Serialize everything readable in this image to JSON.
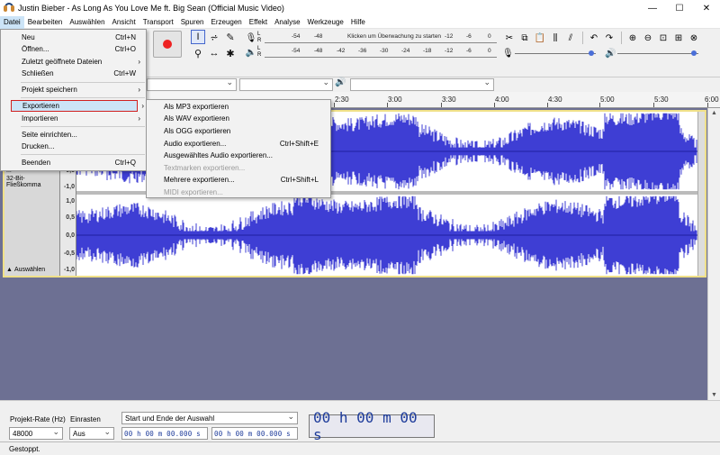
{
  "window": {
    "title": "Justin Bieber - As Long As You Love Me ft. Big Sean (Official Music Video)",
    "minimize": "—",
    "maximize": "☐",
    "close": "✕"
  },
  "menubar": [
    "Datei",
    "Bearbeiten",
    "Auswählen",
    "Ansicht",
    "Transport",
    "Spuren",
    "Erzeugen",
    "Effekt",
    "Analyse",
    "Werkzeuge",
    "Hilfe"
  ],
  "file_menu": {
    "new": {
      "label": "Neu",
      "shortcut": "Ctrl+N"
    },
    "open": {
      "label": "Öffnen...",
      "shortcut": "Ctrl+O"
    },
    "recent": {
      "label": "Zuletzt geöffnete Dateien"
    },
    "close": {
      "label": "Schließen",
      "shortcut": "Ctrl+W"
    },
    "save_project": {
      "label": "Projekt speichern"
    },
    "export": {
      "label": "Exportieren"
    },
    "import": {
      "label": "Importieren"
    },
    "page_setup": {
      "label": "Seite einrichten..."
    },
    "print": {
      "label": "Drucken..."
    },
    "exit": {
      "label": "Beenden",
      "shortcut": "Ctrl+Q"
    }
  },
  "export_submenu": {
    "mp3": {
      "label": "Als MP3 exportieren"
    },
    "wav": {
      "label": "Als WAV exportieren"
    },
    "ogg": {
      "label": "Als OGG exportieren"
    },
    "audio": {
      "label": "Audio exportieren...",
      "shortcut": "Ctrl+Shift+E"
    },
    "selected": {
      "label": "Ausgewähltes Audio exportieren..."
    },
    "labels": {
      "label": "Textmarken exportieren..."
    },
    "multiple": {
      "label": "Mehrere exportieren...",
      "shortcut": "Ctrl+Shift+L"
    },
    "midi": {
      "label": "MIDI exportieren..."
    }
  },
  "meters": {
    "record_scale": [
      "-54",
      "-48",
      "-12",
      "-6",
      "0"
    ],
    "record_hint": "Klicken um Überwachung zu starten",
    "play_scale": [
      "-54",
      "-48",
      "-42",
      "-36",
      "-30",
      "-24",
      "-18",
      "-12",
      "-6",
      "0"
    ],
    "channels": [
      "L",
      "R"
    ]
  },
  "timeline": [
    "2:30",
    "3:00",
    "3:30",
    "4:00",
    "4:30",
    "5:00",
    "5:30",
    "6:00"
  ],
  "track": {
    "format1": "...",
    "format2": "32-Bit-Fließkomma",
    "select_button": "Auswählen",
    "ruler": [
      "-0,5",
      "-1,0",
      "1,0",
      "0,5",
      "0,0",
      "-0,5",
      "-1,0"
    ]
  },
  "selection_toolbar": {
    "rate_label": "Projekt-Rate (Hz)",
    "rate_value": "48000",
    "snap_label": "Einrasten",
    "snap_value": "Aus",
    "mode_value": "Start und Ende der Auswahl",
    "start_time": "00 h 00 m 00.000 s",
    "end_time": "00 h 00 m 00.000 s",
    "audio_position": "00 h 00 m 00 s"
  },
  "status": "Gestoppt.",
  "colors": {
    "waveform": "#3e3ed4",
    "track_bg": "#6d7093",
    "menu_highlight": "#cce4f7",
    "highlight_border": "#d02020"
  }
}
